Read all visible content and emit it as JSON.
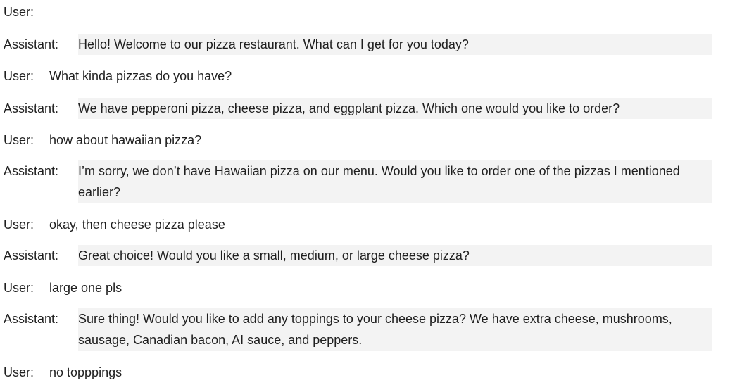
{
  "conversation": [
    {
      "speaker": "User:",
      "role": "user",
      "text": ""
    },
    {
      "speaker": "Assistant:",
      "role": "assistant",
      "text": "Hello! Welcome to our pizza restaurant. What can I get for you today?"
    },
    {
      "speaker": "User:",
      "role": "user",
      "text": "What kinda pizzas do you have?"
    },
    {
      "speaker": "Assistant:",
      "role": "assistant",
      "text": "We have pepperoni pizza, cheese pizza, and eggplant pizza. Which one would you like to order?"
    },
    {
      "speaker": "User:",
      "role": "user",
      "text": "how about hawaiian pizza?"
    },
    {
      "speaker": "Assistant:",
      "role": "assistant",
      "text": "I’m sorry, we don’t have Hawaiian pizza on our menu. Would you like to order one of the pizzas I mentioned earlier?"
    },
    {
      "speaker": "User:",
      "role": "user",
      "text": "okay, then cheese pizza please"
    },
    {
      "speaker": "Assistant:",
      "role": "assistant",
      "text": "Great choice! Would you like a small, medium, or large cheese pizza?"
    },
    {
      "speaker": "User:",
      "role": "user",
      "text": "large one pls"
    },
    {
      "speaker": "Assistant:",
      "role": "assistant",
      "text": "Sure thing! Would you like to add any toppings to your cheese pizza? We have extra cheese, mushrooms, sausage, Canadian bacon, AI sauce, and peppers."
    },
    {
      "speaker": "User:",
      "role": "user",
      "text": "no topppings"
    }
  ]
}
